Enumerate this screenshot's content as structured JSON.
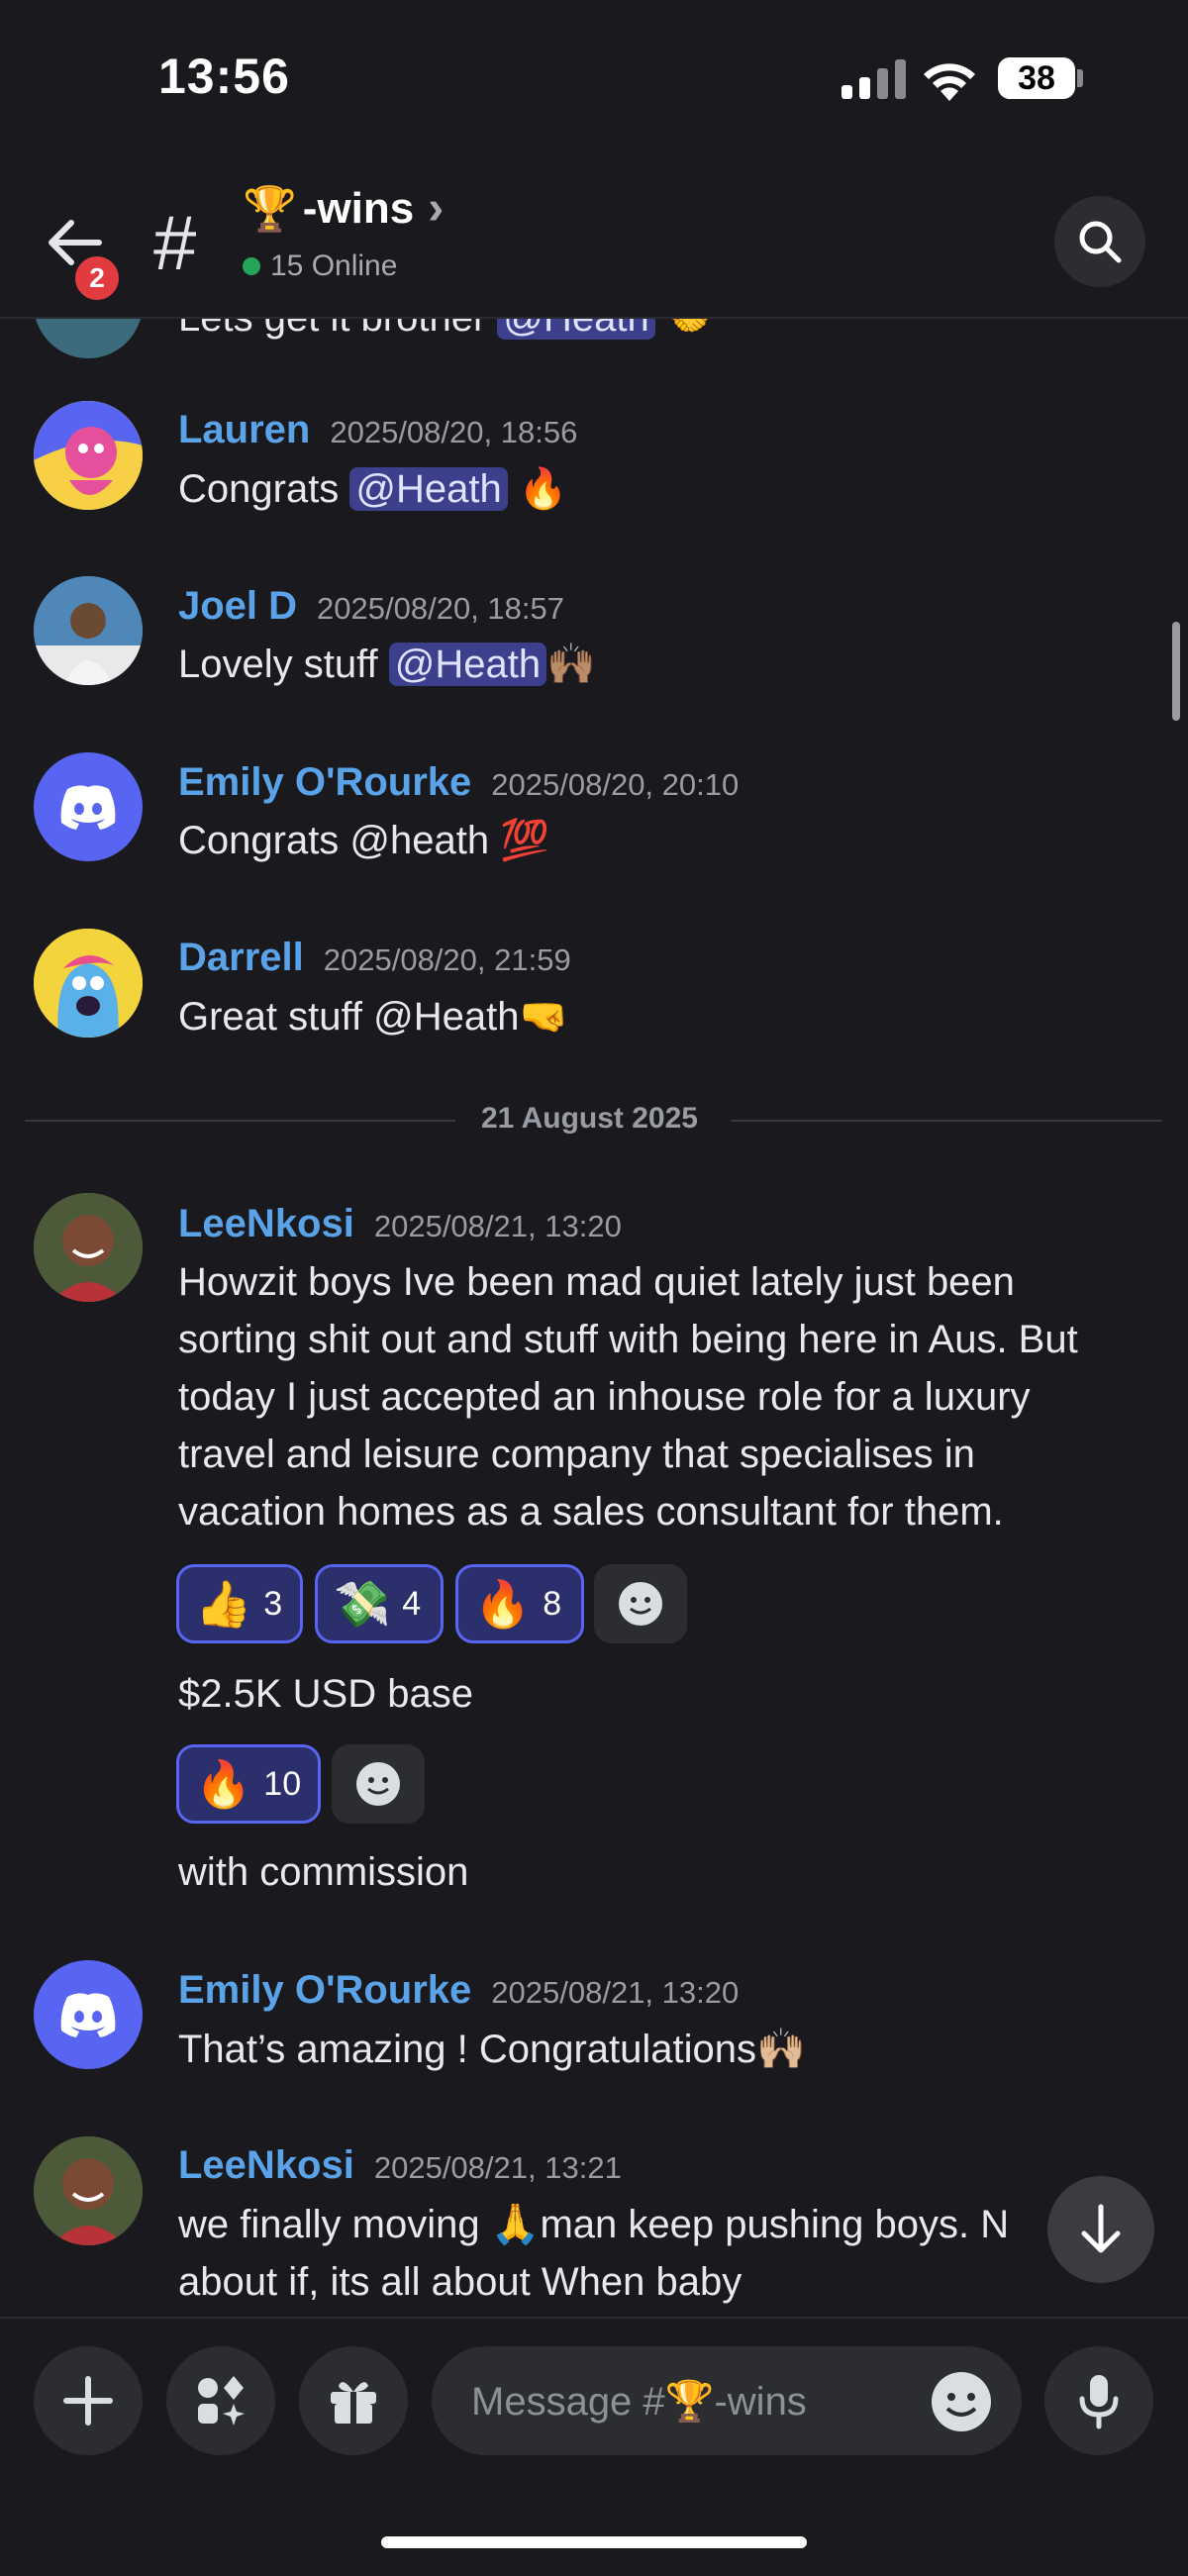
{
  "status_bar": {
    "time": "13:56",
    "battery": "38"
  },
  "header": {
    "notification_count": "2",
    "hash": "#",
    "channel_emoji": "🏆",
    "channel_name": "-wins",
    "chevron": "›",
    "online_text": "15 Online"
  },
  "partial_message": {
    "text_before": "Lets get it brother ",
    "mention": "@Heath",
    "emoji": "🤝"
  },
  "messages": [
    {
      "author": "Lauren",
      "timestamp": "2025/08/20, 18:56",
      "pre": "Congrats ",
      "mention": "@Heath",
      "post": " 🔥"
    },
    {
      "author": "Joel D",
      "timestamp": "2025/08/20, 18:57",
      "pre": "Lovely stuff ",
      "mention": "@Heath",
      "post": "🙌🏽"
    },
    {
      "author": "Emily O'Rourke",
      "timestamp": "2025/08/20, 20:10",
      "text": "Congrats @heath 💯"
    },
    {
      "author": "Darrell",
      "timestamp": "2025/08/20, 21:59",
      "text": "Great stuff @Heath🤜"
    }
  ],
  "date_divider": "21 August 2025",
  "lee_message": {
    "author": "LeeNkosi",
    "timestamp": "2025/08/21, 13:20",
    "lines": [
      "Howzit boys Ive been mad quiet lately just been",
      "sorting shit out and stuff with being here in Aus. But",
      "today I just accepted an inhouse role for a luxury",
      "travel and leisure company that specialises in",
      "vacation homes as a sales consultant for them."
    ],
    "reactions": [
      {
        "emoji": "👍",
        "count": "3"
      },
      {
        "emoji": "💸",
        "count": "4"
      },
      {
        "emoji": "🔥",
        "count": "8"
      }
    ],
    "followup_1": "$2.5K USD base",
    "reactions_2": [
      {
        "emoji": "🔥",
        "count": "10"
      }
    ],
    "followup_2": "with commission"
  },
  "emily_message": {
    "author": "Emily O'Rourke",
    "timestamp": "2025/08/21, 13:20",
    "text": "That’s amazing ! Congratulations🙌🏼"
  },
  "lee_message_2": {
    "author": "LeeNkosi",
    "timestamp": "2025/08/21, 13:21",
    "line1": "we finally moving 🙏man keep pushing boys. N",
    "line2": "about if, its all about When baby"
  },
  "composer": {
    "placeholder": "Message #🏆-wins"
  },
  "colors": {
    "accent": "#5865f2",
    "author": "#5aa3e8",
    "online": "#23a55a",
    "badge": "#e23b3f",
    "background": "#1a1a1e"
  }
}
